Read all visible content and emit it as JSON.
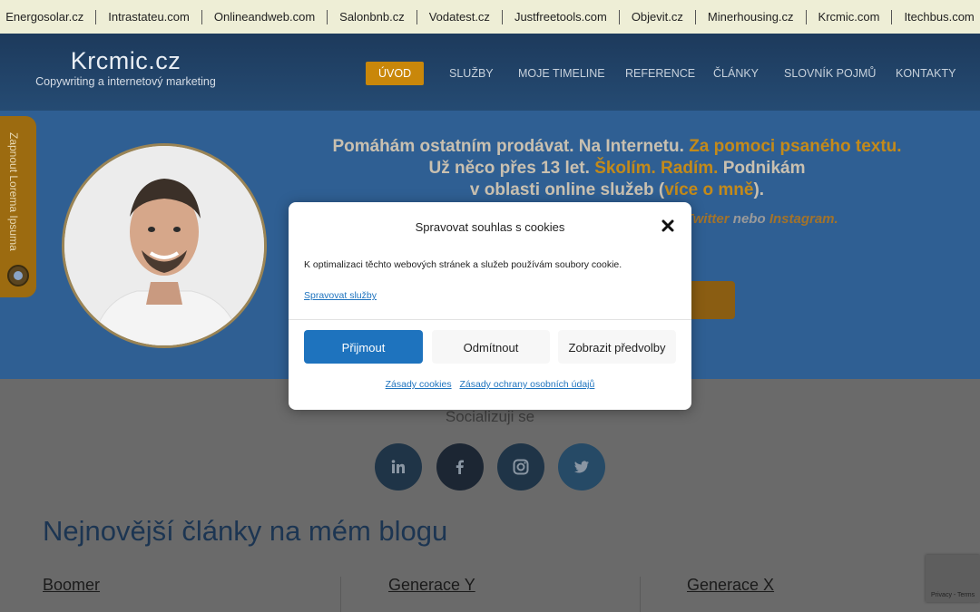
{
  "topbar": {
    "links": [
      "Energosolar.cz",
      "Intrastateu.com",
      "Onlineandweb.com",
      "Salonbnb.cz",
      "Vodatest.cz",
      "Justfreetools.com",
      "Objevit.cz",
      "Minerhousing.cz",
      "Krcmic.com",
      "Itechbus.com"
    ]
  },
  "header": {
    "brand_title": "Krcmic.cz",
    "brand_subtitle": "Copywriting a internetový marketing",
    "nav": [
      "Úvod",
      "Služby",
      "Moje timeline",
      "Reference",
      "Články",
      "Slovník pojmů",
      "Kontakty"
    ]
  },
  "hero": {
    "side_tab_label": "Zapnout Lorema Ipsuma",
    "line1_a": "Pomáhám ostatním prodávat. Na Internetu.",
    "line1_b": "Za pomoci psaného textu.",
    "line2_a": "Už něco přes 13 let.",
    "line2_b": "Školím.",
    "line2_c": "Radím.",
    "line2_d": "Podnikám",
    "line3_a": "v oblasti online služeb (",
    "line3_b": "více o mně",
    "line3_c": ").",
    "sub_a": "Twitter",
    "sub_b": "nebo",
    "sub_c": "Instagram."
  },
  "social": {
    "title": "Socializuji se",
    "icons": [
      "linkedin-icon",
      "facebook-icon",
      "instagram-icon",
      "twitter-icon"
    ]
  },
  "blog": {
    "title": "Nejnovější články na mém blogu",
    "articles": [
      "Boomer",
      "Generace Y",
      "Generace X"
    ]
  },
  "recaptcha": {
    "text": "Privacy - Terms"
  },
  "cookie_modal": {
    "title": "Spravovat souhlas s cookies",
    "body": "K optimalizaci těchto webových stránek a služeb používám soubory cookie.",
    "manage_link": "Spravovat služby",
    "accept": "Přijmout",
    "deny": "Odmítnout",
    "preferences": "Zobrazit předvolby",
    "cookie_policy": "Zásady cookies",
    "privacy_policy": "Zásady ochrany osobních údajů"
  },
  "colors": {
    "accent": "#c9870a",
    "primary_button": "#1e73be",
    "header_bg": "#1d3a5c"
  }
}
